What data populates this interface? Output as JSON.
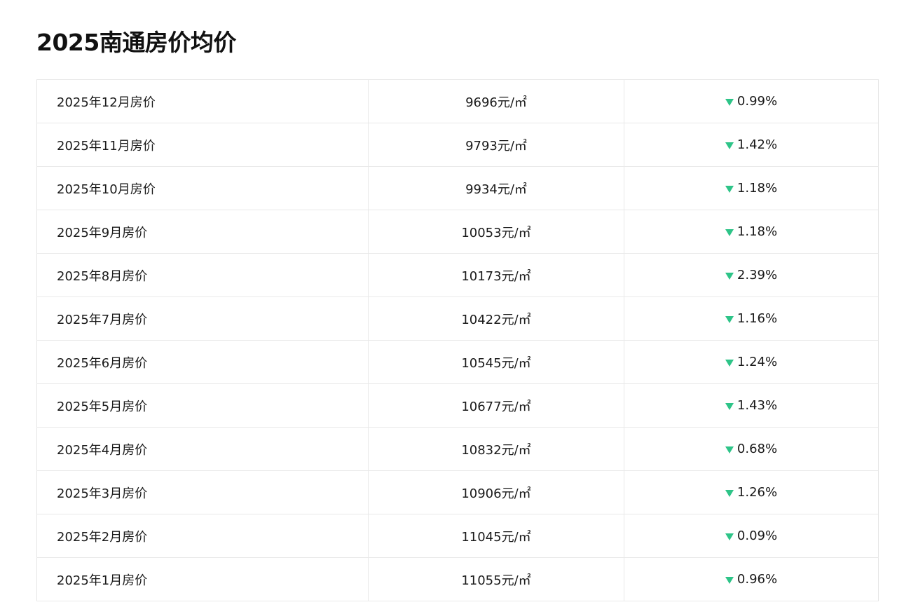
{
  "page": {
    "title": "2025南通房价均价"
  },
  "colors": {
    "down_indicator": "#2ec488",
    "border": "#e9e9e9"
  },
  "table": {
    "rows": [
      {
        "month": "2025年12月房价",
        "price": "9696元/㎡",
        "change_direction": "down",
        "change_icon": "triangle-down-icon",
        "change": "0.99%"
      },
      {
        "month": "2025年11月房价",
        "price": "9793元/㎡",
        "change_direction": "down",
        "change_icon": "triangle-down-icon",
        "change": "1.42%"
      },
      {
        "month": "2025年10月房价",
        "price": "9934元/㎡",
        "change_direction": "down",
        "change_icon": "triangle-down-icon",
        "change": "1.18%"
      },
      {
        "month": "2025年9月房价",
        "price": "10053元/㎡",
        "change_direction": "down",
        "change_icon": "triangle-down-icon",
        "change": "1.18%"
      },
      {
        "month": "2025年8月房价",
        "price": "10173元/㎡",
        "change_direction": "down",
        "change_icon": "triangle-down-icon",
        "change": "2.39%"
      },
      {
        "month": "2025年7月房价",
        "price": "10422元/㎡",
        "change_direction": "down",
        "change_icon": "triangle-down-icon",
        "change": "1.16%"
      },
      {
        "month": "2025年6月房价",
        "price": "10545元/㎡",
        "change_direction": "down",
        "change_icon": "triangle-down-icon",
        "change": "1.24%"
      },
      {
        "month": "2025年5月房价",
        "price": "10677元/㎡",
        "change_direction": "down",
        "change_icon": "triangle-down-icon",
        "change": "1.43%"
      },
      {
        "month": "2025年4月房价",
        "price": "10832元/㎡",
        "change_direction": "down",
        "change_icon": "triangle-down-icon",
        "change": "0.68%"
      },
      {
        "month": "2025年3月房价",
        "price": "10906元/㎡",
        "change_direction": "down",
        "change_icon": "triangle-down-icon",
        "change": "1.26%"
      },
      {
        "month": "2025年2月房价",
        "price": "11045元/㎡",
        "change_direction": "down",
        "change_icon": "triangle-down-icon",
        "change": "0.09%"
      },
      {
        "month": "2025年1月房价",
        "price": "11055元/㎡",
        "change_direction": "down",
        "change_icon": "triangle-down-icon",
        "change": "0.96%"
      }
    ]
  }
}
